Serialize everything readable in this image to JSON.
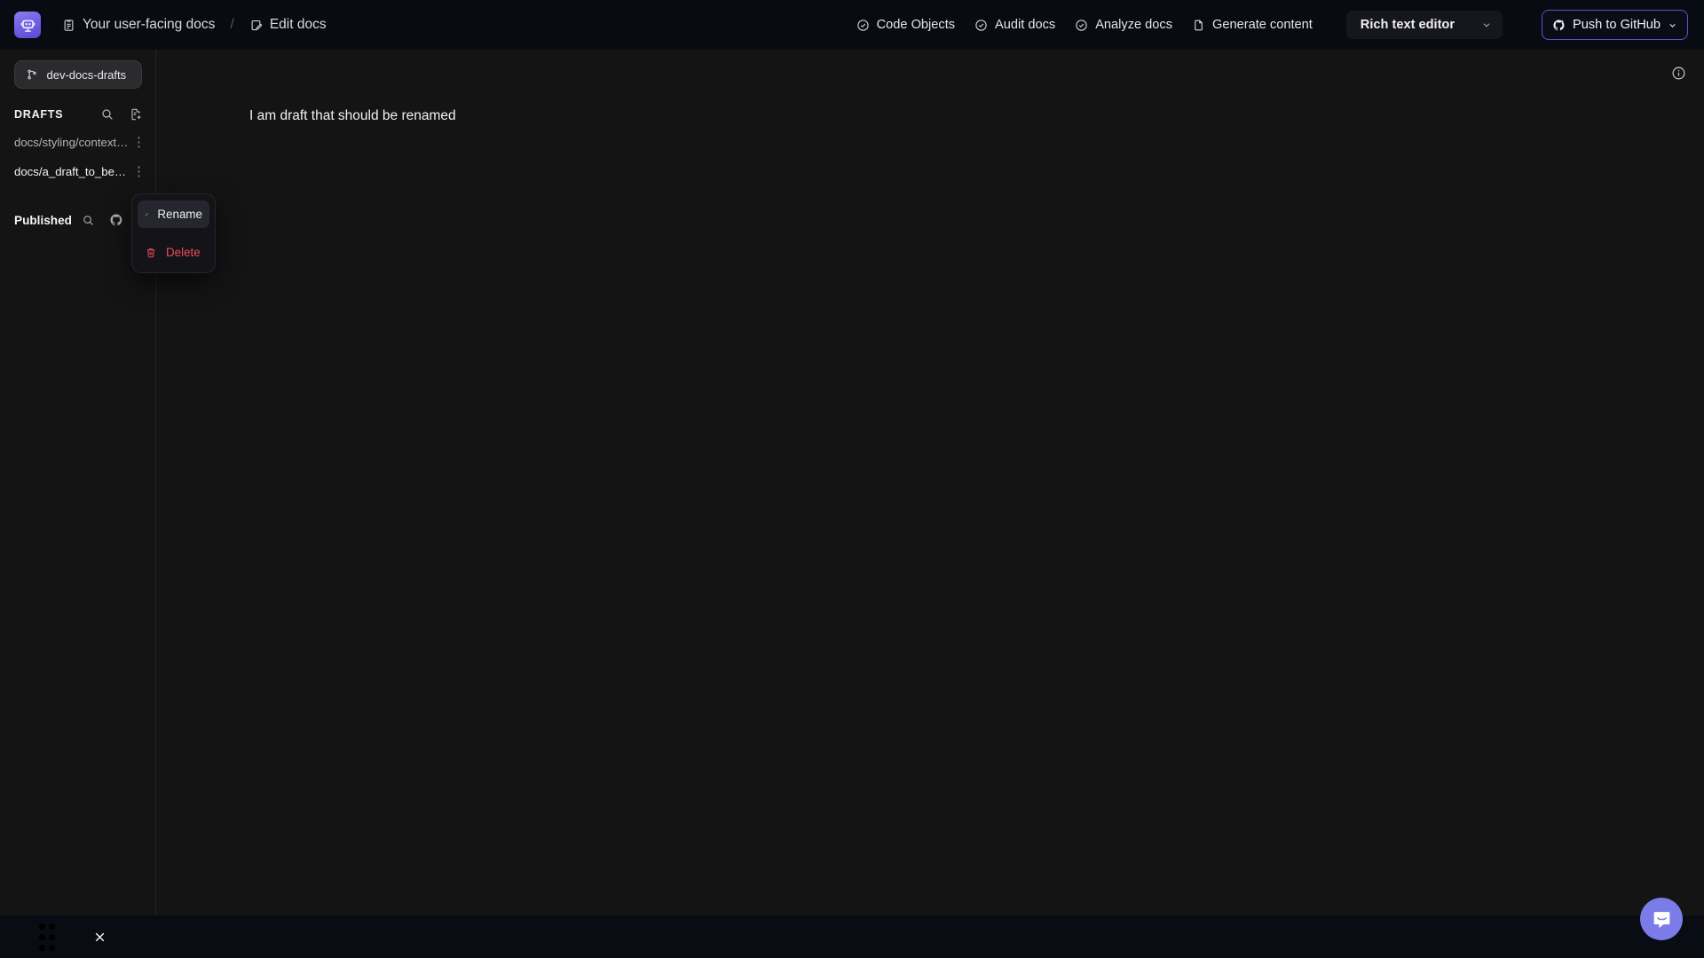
{
  "app": {
    "logo_icon": "robot-face-icon",
    "accent_color": "#7b7ce8",
    "push_border_color": "#5b54c9",
    "danger_color": "#ef4a58"
  },
  "breadcrumb": {
    "items": [
      {
        "label": "Your user-facing docs",
        "icon": "clipboard-doc-icon"
      },
      {
        "label": "Edit docs",
        "icon": "doc-pencil-icon"
      }
    ],
    "separator": "/"
  },
  "toolbar": {
    "items": [
      {
        "label": "Code Objects",
        "icon": "circle-check-icon"
      },
      {
        "label": "Audit docs",
        "icon": "circle-check-icon"
      },
      {
        "label": "Analyze docs",
        "icon": "circle-check-icon"
      },
      {
        "label": "Generate content",
        "icon": "file-text-icon"
      }
    ],
    "editor_mode": {
      "label": "Rich text editor",
      "icon": "chevron-down-icon"
    },
    "push": {
      "label": "Push to GitHub",
      "icon": "github-push-icon",
      "chevron": "chevron-down-icon"
    }
  },
  "sidebar": {
    "branch": {
      "label": "dev-docs-drafts",
      "icon": "git-branch-icon"
    },
    "drafts": {
      "title": "DRAFTS",
      "search_icon": "search-icon",
      "new_doc_icon": "new-document-icon",
      "items": [
        {
          "label": "docs/styling/context…",
          "kebab": "⋮",
          "active": false
        },
        {
          "label": "docs/a_draft_to_be_ren",
          "kebab": "⋮",
          "active": true
        }
      ]
    },
    "published": {
      "title": "Published",
      "search_icon": "search-icon",
      "github_icon": "github-icon"
    }
  },
  "context_menu": {
    "items": [
      {
        "label": "Rename",
        "icon": "pencil-icon",
        "highlighted": true
      },
      {
        "label": "Delete",
        "icon": "trash-icon",
        "danger": true
      }
    ]
  },
  "editor": {
    "document_text": "I am draft that should be renamed",
    "info_icon": "info-circle-icon"
  },
  "bottom_bar": {
    "grip_icon": "drag-handle-dots-icon",
    "close_icon": "close-x-icon"
  },
  "chat": {
    "icon": "intercom-message-icon"
  }
}
